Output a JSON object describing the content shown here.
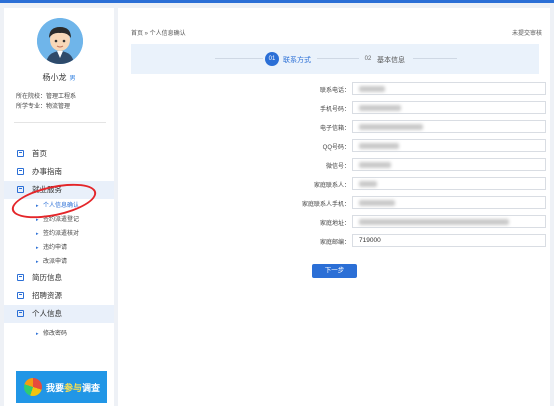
{
  "user": {
    "name": "杨小龙",
    "tag": "男",
    "school_label": "所在院校：",
    "school": "管理工程系",
    "major_label": "所学专业：",
    "major": "物流管理"
  },
  "sidebar": {
    "items": [
      {
        "label": "首页"
      },
      {
        "label": "办事指南"
      },
      {
        "label": "就业服务"
      },
      {
        "label": "简历信息"
      },
      {
        "label": "招聘资源"
      },
      {
        "label": "个人信息"
      }
    ],
    "employment_sub": [
      {
        "label": "个人信息确认"
      },
      {
        "label": "签约派遣登记"
      },
      {
        "label": "签约派遣核对"
      },
      {
        "label": "违约申请"
      },
      {
        "label": "改派申请"
      }
    ],
    "profile_sub": [
      {
        "label": "修改密码"
      }
    ],
    "survey": {
      "prefix": "我要",
      "highlight": "参与",
      "suffix": "调查"
    }
  },
  "breadcrumb": "首页 » 个人信息确认",
  "status": "未提交审核",
  "steps": [
    {
      "num": "01",
      "label": "联系方式",
      "active": true
    },
    {
      "num": "02",
      "label": "基本信息",
      "active": false
    }
  ],
  "form": {
    "fields": [
      {
        "label": "联系电话：",
        "value": "",
        "redacted": true
      },
      {
        "label": "手机号码：",
        "value": "",
        "redacted": true
      },
      {
        "label": "电子信箱：",
        "value": "",
        "redacted": true
      },
      {
        "label": "QQ号码：",
        "value": "",
        "redacted": true
      },
      {
        "label": "微信号：",
        "value": "",
        "redacted": true
      },
      {
        "label": "家庭联系人：",
        "value": "",
        "redacted": true
      },
      {
        "label": "家庭联系人手机：",
        "value": "",
        "redacted": true
      },
      {
        "label": "家庭地址：",
        "value": "",
        "redacted": true
      },
      {
        "label": "家庭邮编：",
        "value": "719000",
        "redacted": false
      }
    ],
    "next_label": "下一步"
  },
  "colors": {
    "accent": "#2b6fd6",
    "annotation": "#e4262a",
    "survey_bg": "#2196e6"
  }
}
